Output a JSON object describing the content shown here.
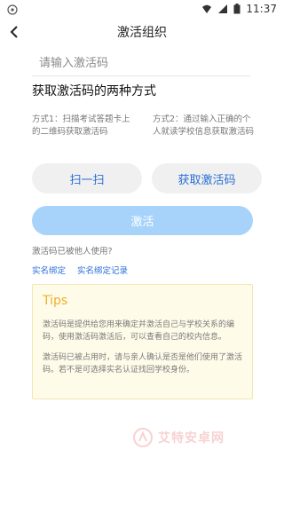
{
  "status_bar": {
    "time": "11:37"
  },
  "header": {
    "title": "激活组织"
  },
  "input": {
    "placeholder": "请输入激活码",
    "value": ""
  },
  "section_title": "获取激活码的两种方式",
  "methods": [
    {
      "text": "方式1：扫描考试答题卡上的二维码获取激活码"
    },
    {
      "text": "方式2：通过输入正确的个人就读学校信息获取激活码"
    }
  ],
  "buttons": {
    "scan": "扫一扫",
    "get_code": "获取激活码",
    "activate": "激活"
  },
  "used_question": "激活码已被他人使用?",
  "links": {
    "bind": "实名绑定",
    "records": "实名绑定记录"
  },
  "tips": {
    "title": "Tips",
    "para1": "激活码是提供给您用来确定并激活自己与学校关系的编码，使用激活码激活后，可以查看自己的校内信息。",
    "para2": "激活码已被占用时，请与亲人确认是否是他们使用了激活码。若不是可选择实名认证找回学校身份。"
  },
  "watermark": {
    "text": "艾特安卓网"
  },
  "colors": {
    "accent": "#2a6fd6",
    "activate_disabled": "#a7d3fb",
    "tips_title": "#e9b12a",
    "tips_bg": "#fffbe9"
  }
}
